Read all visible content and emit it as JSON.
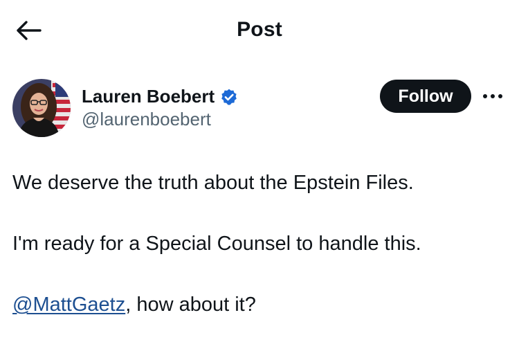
{
  "header": {
    "title": "Post",
    "back_icon": "arrow-left-icon"
  },
  "author": {
    "display_name": "Lauren Boebert",
    "handle": "@laurenboebert",
    "verified": true,
    "verified_color": "#1d9bf0",
    "avatar_icon": "profile-photo"
  },
  "actions": {
    "follow_label": "Follow",
    "more_icon": "more-horizontal-icon"
  },
  "post": {
    "line1": "We deserve the truth about the Epstein Files.",
    "line2": "I'm ready for a Special Counsel to handle this.",
    "mention": "@MattGaetz",
    "line3_rest": ", how about it?"
  },
  "colors": {
    "text": "#0f1419",
    "secondary": "#536471",
    "link": "#1d4f91",
    "button_bg": "#0f1419"
  }
}
